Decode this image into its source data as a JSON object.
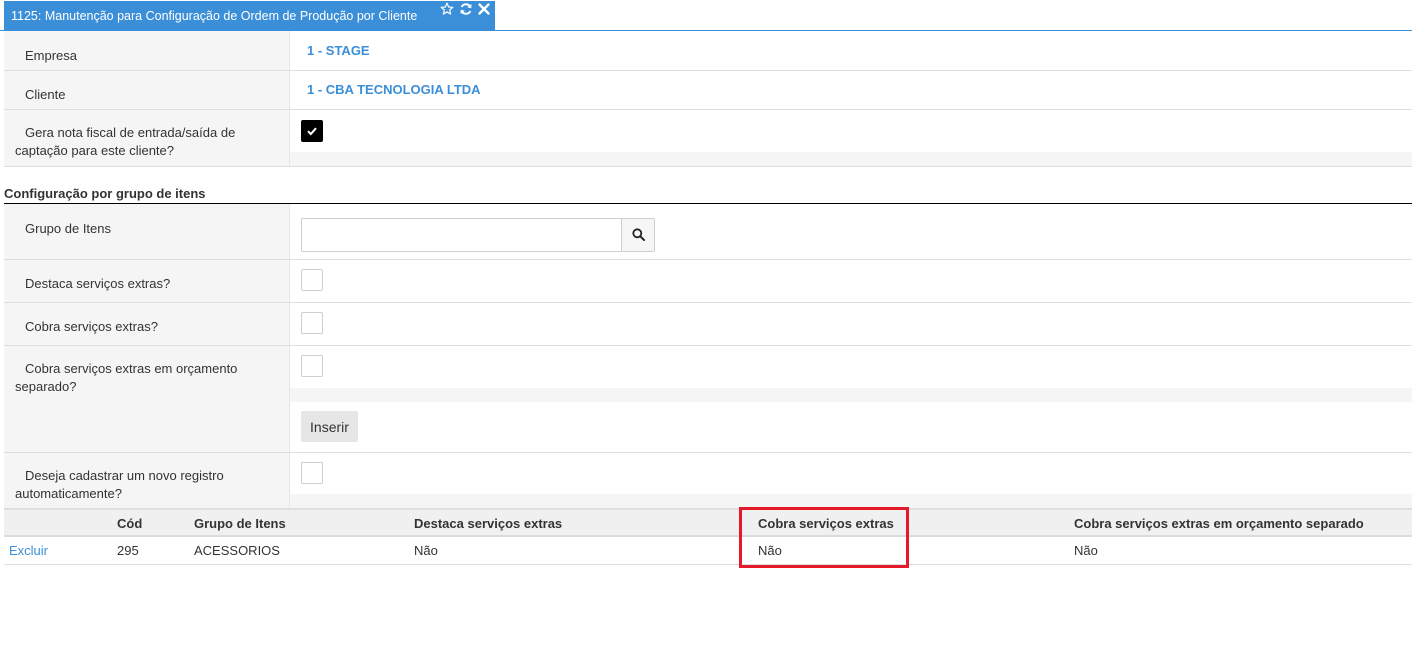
{
  "tab": {
    "title": "1125: Manutenção para Configuração de Ordem de Produção por Cliente",
    "icons": [
      "star-icon",
      "refresh-icon",
      "close-icon"
    ]
  },
  "form": {
    "empresa_label": "Empresa",
    "empresa_value": "1 - STAGE",
    "cliente_label": "Cliente",
    "cliente_value": "1 - CBA TECNOLOGIA LTDA",
    "gera_nota_label": "Gera nota fiscal de entrada/saída de captação para este cliente?",
    "gera_nota_checked": true
  },
  "section": {
    "title": "Configuração por grupo de itens",
    "grupo_label": "Grupo de Itens",
    "grupo_value": "",
    "destaca_label": "Destaca serviços extras?",
    "destaca_checked": false,
    "cobra_label": "Cobra serviços extras?",
    "cobra_checked": false,
    "cobra_orc_label": "Cobra serviços extras em orçamento separado?",
    "cobra_orc_checked": false,
    "insert_button": "Inserir",
    "auto_label": "Deseja cadastrar um novo registro automaticamente?",
    "auto_checked": false
  },
  "grid": {
    "headers": [
      "",
      "Cód",
      "Grupo de Itens",
      "Destaca serviços extras",
      "Cobra serviços extras",
      "Cobra serviços extras em orçamento separado"
    ],
    "rows": [
      {
        "action": "Excluir",
        "cod": "295",
        "grupo": "ACESSORIOS",
        "destaca": "Não",
        "cobra": "Não",
        "cobra_orc": "Não"
      }
    ]
  },
  "colors": {
    "accent": "#3b8fd8",
    "highlight": "#e41a2a"
  }
}
